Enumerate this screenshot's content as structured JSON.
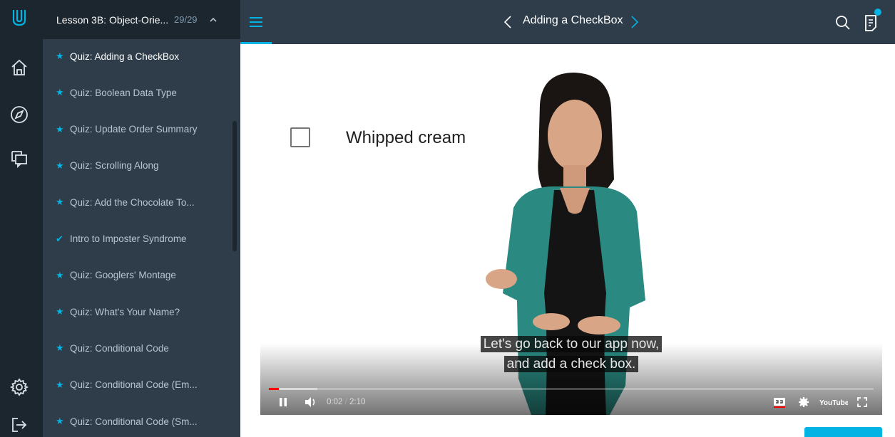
{
  "sidebar_header": {
    "title": "Lesson 3B: Object-Orie...",
    "count": "29/29"
  },
  "lessons": [
    {
      "label": "Quiz: Adding a CheckBox",
      "status": "star",
      "active": true
    },
    {
      "label": "Quiz: Boolean Data Type",
      "status": "star",
      "active": false
    },
    {
      "label": "Quiz: Update Order Summary",
      "status": "star",
      "active": false
    },
    {
      "label": "Quiz: Scrolling Along",
      "status": "star",
      "active": false
    },
    {
      "label": "Quiz: Add the Chocolate To...",
      "status": "star",
      "active": false
    },
    {
      "label": "Intro to Imposter Syndrome",
      "status": "check",
      "active": false
    },
    {
      "label": "Quiz: Googlers' Montage",
      "status": "star",
      "active": false
    },
    {
      "label": "Quiz: What's Your Name?",
      "status": "star",
      "active": false
    },
    {
      "label": "Quiz: Conditional Code",
      "status": "star",
      "active": false
    },
    {
      "label": "Quiz: Conditional Code (Em...",
      "status": "star",
      "active": false
    },
    {
      "label": "Quiz: Conditional Code (Sm...",
      "status": "star",
      "active": false
    }
  ],
  "topbar": {
    "title": "Adding a CheckBox"
  },
  "video": {
    "checkbox_label": "Whipped cream",
    "captions": [
      "Let's go back to our app now,",
      "and add a check box."
    ],
    "time_current": "0:02",
    "time_separator": "/",
    "time_total": "2:10",
    "progress": 0.016,
    "buffered": 0.08,
    "youtube_logo": "YouTube"
  },
  "colors": {
    "accent": "#02b3e4",
    "sidebar_bg": "#2e3d49",
    "rail_bg": "#1c262f",
    "progress": "#ff0000"
  },
  "icons": {
    "rail": [
      "udacity-logo-icon",
      "home-icon",
      "compass-icon",
      "chat-icon",
      "settings-gear-icon",
      "logout-icon"
    ],
    "topbar": [
      "hamburger-menu-icon",
      "chevron-left-icon",
      "chevron-right-icon",
      "search-icon",
      "notes-icon"
    ],
    "video_controls": [
      "pause-icon",
      "volume-icon",
      "captions-icon",
      "settings-icon",
      "youtube-logo-icon",
      "fullscreen-icon"
    ]
  }
}
